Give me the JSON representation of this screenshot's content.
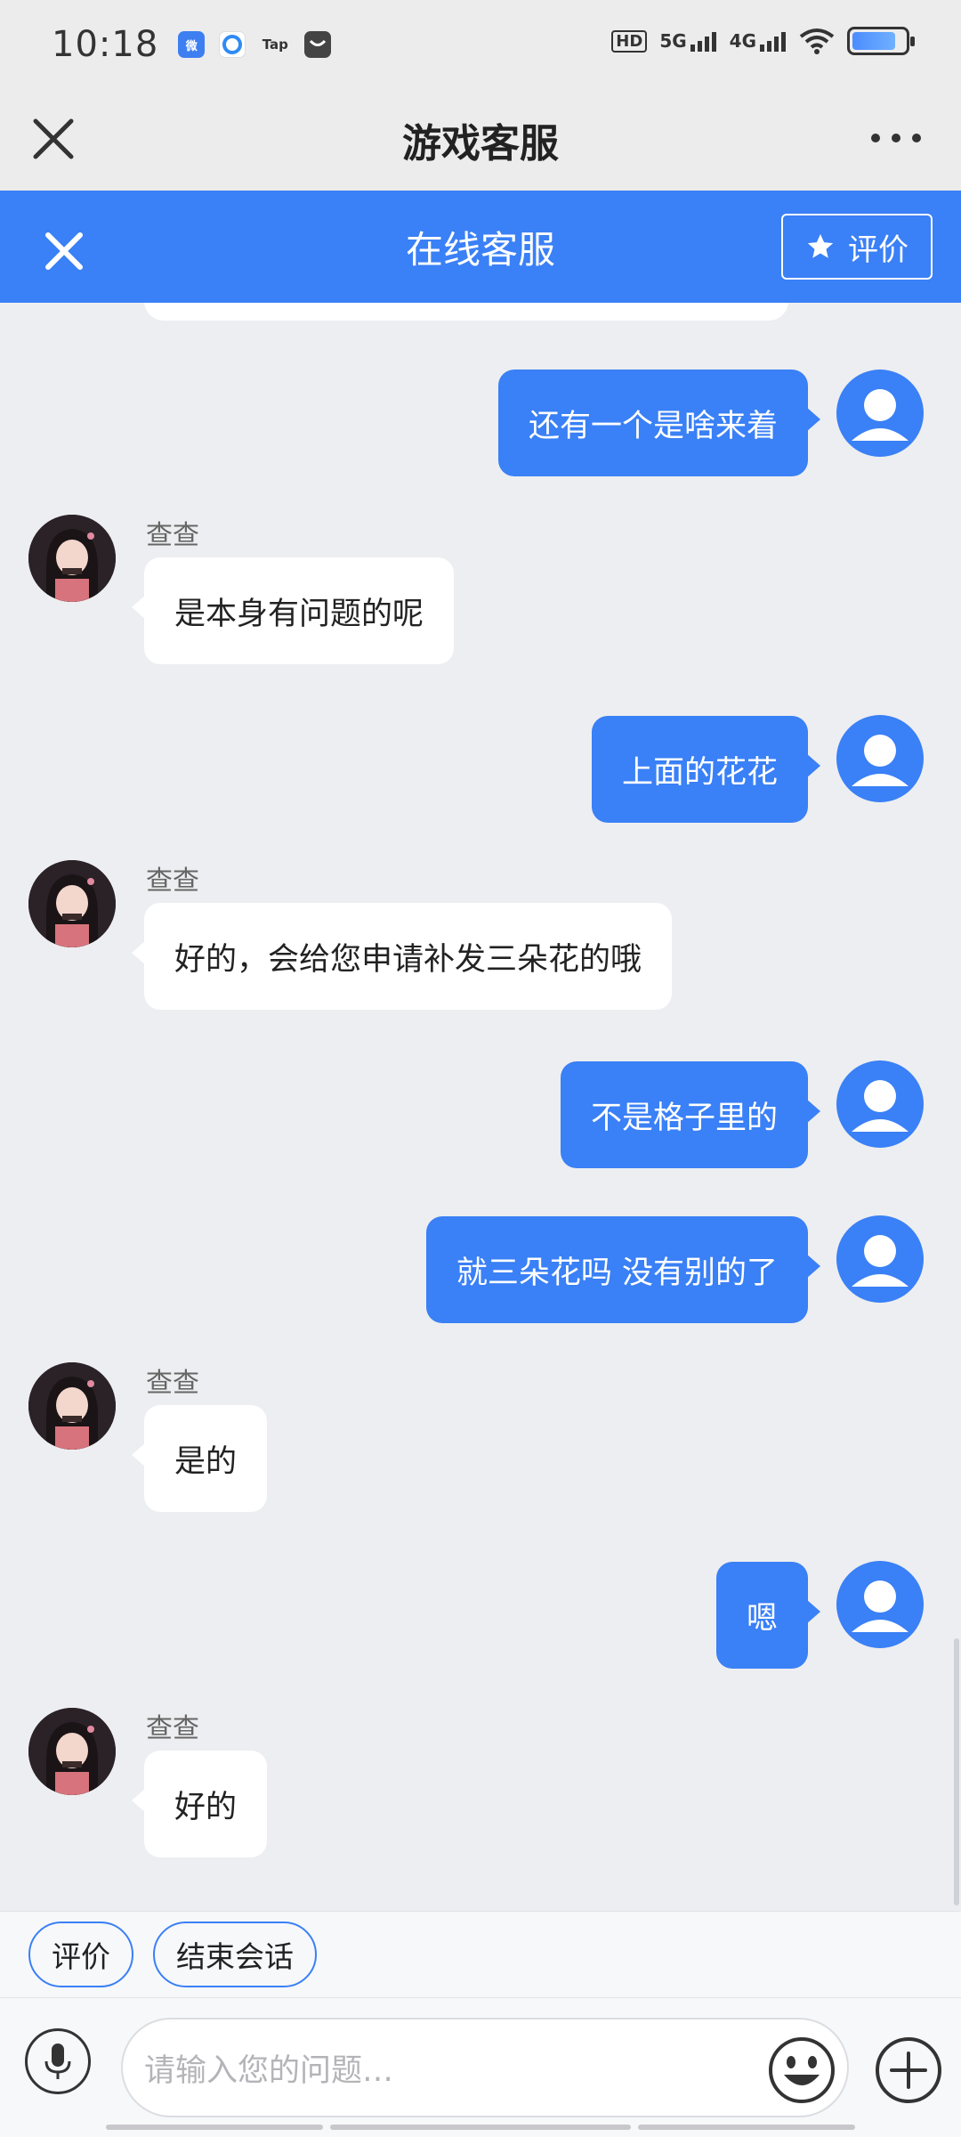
{
  "status_bar": {
    "time": "10:18",
    "app_icons": [
      "weibo-icon",
      "browser-icon",
      "taptap-icon",
      "message-icon"
    ],
    "icons": [
      "hd-icon",
      "5g-signal-icon",
      "4g-signal-icon",
      "wifi-icon",
      "battery-icon"
    ],
    "hd": "HD",
    "sig1": "5G",
    "sig2": "4G"
  },
  "titlebar": {
    "title": "游戏客服"
  },
  "header": {
    "title": "在线客服",
    "rate_label": "评价"
  },
  "messages": [
    {
      "side": "right",
      "text": "还有一个是啥来着"
    },
    {
      "side": "left",
      "name": "查查",
      "text": "是本身有问题的呢"
    },
    {
      "side": "right",
      "text": "上面的花花"
    },
    {
      "side": "left",
      "name": "查查",
      "text": "好的，会给您申请补发三朵花的哦"
    },
    {
      "side": "right",
      "text": "不是格子里的"
    },
    {
      "side": "right",
      "text": "就三朵花吗  没有别的了"
    },
    {
      "side": "left",
      "name": "查查",
      "text": "是的"
    },
    {
      "side": "right",
      "text": "嗯"
    },
    {
      "side": "left",
      "name": "查查",
      "text": "好的"
    }
  ],
  "quick_actions": [
    "评价",
    "结束会话"
  ],
  "input": {
    "placeholder": "请输入您的问题…"
  },
  "colors": {
    "accent": "#3a80f6",
    "background": "#edeef1",
    "bubble_left": "#ffffff"
  }
}
